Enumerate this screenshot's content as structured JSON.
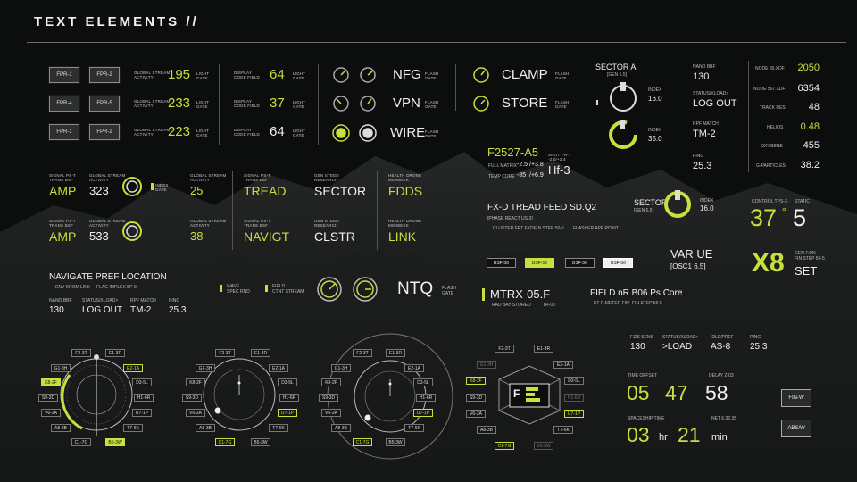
{
  "header": {
    "title": "TEXT ELEMENTS //"
  },
  "colors": {
    "accent": "#c8df3e",
    "text": "#f0f0f0",
    "bg": "#0c0d0d"
  },
  "fpr_block": {
    "buttons": [
      "FPR-1",
      "FPR-2",
      "FPR-4",
      "FPR-5",
      "FPR-1",
      "FPR-2"
    ],
    "rows": [
      {
        "label": "GLOBAL STREAM\nACTIVITY",
        "value": "195",
        "unit": "LIGHT\nGATE",
        "label2": "DISPLAY\nCODE FIELD",
        "value2": "64",
        "unit2": "LIGHT\nGATE"
      },
      {
        "label": "GLOBAL STREAM\nACTIVITY",
        "value": "233",
        "unit": "LIGHT\nGATE",
        "label2": "DISPLAY\nCODE FIELD",
        "value2": "37",
        "unit2": "LIGHT\nGATE"
      },
      {
        "label": "GLOBAL STREAM\nACTIVITY",
        "value": "223",
        "unit": "LIGHT\nGATE",
        "label2": "DISPLAY\nCODE FIELD",
        "value2": "64",
        "unit2": "LIGHT\nGATE"
      }
    ]
  },
  "knob_words": [
    {
      "word": "NFG",
      "unit": "FLASH\nGATE"
    },
    {
      "word": "VPN",
      "unit": "FLASH\nGATE"
    },
    {
      "word": "WIRE",
      "unit": "FLASH\nGATE"
    }
  ],
  "clamp": {
    "a": "CLAMP",
    "a_unit": "FLASH\nGATE",
    "b": "STORE",
    "b_unit": "FLASH\nGATE"
  },
  "sector_a": {
    "title": "SECTOR A",
    "sub": "[GEN 6.5]",
    "index1_label": "INDEX",
    "index1": "16.0",
    "index2_label": "INDEX",
    "index2": "35.0"
  },
  "f2527": {
    "title": "F2527-A5",
    "r1l": "FULL MATRIX",
    "r1a": "-2.5",
    "r1b": "/+3.8",
    "r2l": "TEMP CORE",
    "r2a": "-85",
    "r2b": "/+6.9",
    "split_label": "SPLIT FR-7\n-2.0/+2.4",
    "split": "Hf-3"
  },
  "nano_col": {
    "nano_label": "NANO BBF",
    "nano": "130",
    "status_label": "STATUS/XLOAD>",
    "status": "LOG OUT",
    "rpf_label": "RPF MATCH",
    "rpf": "TM-2",
    "ping_label": "PING",
    "ping": "25.3"
  },
  "node_list": [
    {
      "label": "NODE 30.XDF",
      "value": "2050",
      "accent": true
    },
    {
      "label": "NODE 567.XDF",
      "value": "6354",
      "accent": false
    },
    {
      "label": "TRACK RES.",
      "value": "48",
      "accent": false
    },
    {
      "label": "HELIOS",
      "value": "0.48",
      "accent": true
    },
    {
      "label": "OXYGENE",
      "value": "455",
      "accent": false
    },
    {
      "label": "G-PARTICLES",
      "value": "38.2",
      "accent": false
    }
  ],
  "amp_rows": [
    {
      "lbl1": "SIGNAL PS-T\nTRANS BSF",
      "w1": "AMP",
      "lbl2": "GLOBAL STREAM\nACTIVITY",
      "n2": "323",
      "lbl3": "GLOBAL STREAM\nACTIVITY",
      "n3": "25",
      "lbl4": "SIGNAL PS-T\nTRANS BSF",
      "w4": "TREAD",
      "lbl5": "GEN STEED\nRESEARCH",
      "w5": "SECTOR",
      "lbl6": "HEALTH DRONE\nMIDWEEK",
      "w6": "FDDS",
      "side": "INDEX\nGATE"
    },
    {
      "lbl1": "SIGNAL PS-T\nTRANS BSF",
      "w1": "AMP",
      "lbl2": "GLOBAL STREAM\nACTIVITY",
      "n2": "533",
      "lbl3": "GLOBAL STREAM\nACTIVITY",
      "n3": "38",
      "lbl4": "SIGNAL PS-T\nTRANS BSF",
      "w4": "NAVIGT",
      "lbl5": "GEN STEED\nRESEARCH",
      "w5": "CLSTR",
      "lbl6": "HEALTH DRONE\nMIDWEEK",
      "w6": "LINK",
      "side": ""
    }
  ],
  "fxd": {
    "title": "FX-D TREAD FEED SD.Q2",
    "sub": "[PHASE REACT US-3]",
    "o1": "CLUSTER FRT FKD",
    "o2": "FIN STEP 50-5",
    "o3": "FLASHER APP POINT"
  },
  "sector_b": {
    "title": "SECTOR",
    "sub": "[GEN 6.5]",
    "index_label": "INDEX",
    "index": "16.0"
  },
  "control": {
    "label": "CONTROL TPS-3",
    "value": "37",
    "static_label": "STATIC",
    "static": "5"
  },
  "chips": [
    "BSF-56",
    "BSF-56",
    "BSF-56",
    "BSF-56"
  ],
  "var": {
    "title": "VAR UE",
    "sub": "[OSC1 6.5]"
  },
  "x8": {
    "big": "X8",
    "gen": "GEN-F.DN\nFIN STEP 50-5",
    "set": "SET"
  },
  "navigate": {
    "title": "NAVIGATE PREF LOCATION",
    "o1": "ENV KROM LINK",
    "o2": "FLAG IMPLEX 5P-9",
    "nano_label": "NANO BBF",
    "nano": "130",
    "status_label": "STATUS/XLOAD>",
    "status": "LOG OUT",
    "rpf_label": "RPF MATCH",
    "rpf": "TM-2",
    "ping_label": "PING",
    "ping": "25.3"
  },
  "wave": {
    "a": "WAVE\nSPEC RND",
    "b": "FIELD\nCTNT STREAM"
  },
  "ntq": {
    "word": "NTQ",
    "unit": "FLASH\nGATE"
  },
  "mtrx": {
    "title": "MTRX-05.F",
    "sub": "RAD BAY STORED",
    "sub2": "TR-00"
  },
  "field": {
    "title": "FIELD nR B06.Ps Core",
    "o1": "KT-R.METER FIN",
    "o2": "FIN STEP 50-5"
  },
  "status_row": {
    "f_label": "F.DS SENS",
    "f": "130",
    "s_label": "STATUS/XLOAD>",
    "s": ">LOAD",
    "i_label": "IDLE/PREF",
    "i": "AS-8",
    "p_label": "PING",
    "p": "25.3"
  },
  "time": {
    "offset_label": "TIME OFFSET",
    "h": "05",
    "m": "47",
    "delay_label": "DELAY Z-03",
    "d": "58",
    "ship_label": "SPACESHIP TIME",
    "net_label": "NET 6.32.35",
    "sh": "03",
    "hr": "hr",
    "sm": "21",
    "min": "min"
  },
  "side_buttons": [
    "FIN-W",
    "ABS/W"
  ],
  "dials": [
    {
      "left": [
        "G1-3H",
        "K8-2F",
        "S9-3D",
        "V6-2A",
        "A8-3B"
      ],
      "top": [
        "F2-3T",
        "E1-3R"
      ],
      "right": [
        "E2-1A",
        "D3-5L",
        "H1-6R",
        "U7-1P",
        "T7-6K"
      ],
      "bottom": [
        "C1-7G",
        "B5-3W"
      ]
    },
    {
      "left": [
        "G1-3H",
        "K8-2F",
        "S9-3D",
        "V6-2A",
        "A8-3B"
      ],
      "top": [
        "F2-3T",
        "E1-3R"
      ],
      "right": [
        "E2-1A",
        "D3-5L",
        "H1-6R",
        "U7-1P",
        "T7-6K"
      ],
      "bottom": [
        "C1-7G",
        "B5-3W"
      ]
    },
    {
      "left": [
        "G1-3H",
        "K8-2F",
        "S9-3D",
        "V6-2A",
        "A8-3B"
      ],
      "top": [
        "F2-3T",
        "E1-3R"
      ],
      "right": [
        "E2-1A",
        "D3-5L",
        "H1-6R",
        "U7-1P",
        "T7-6K"
      ],
      "bottom": [
        "C1-7G",
        "B5-3W"
      ]
    },
    {
      "left": [
        "G1-3H",
        "K8-2F",
        "S9-3D",
        "V6-2A",
        "A8-3B"
      ],
      "top": [
        "F2-3T",
        "E1-3R"
      ],
      "right": [
        "E2-1A",
        "D3-5L",
        "H1-6R",
        "U7-1P",
        "T7-6K"
      ],
      "bottom": [
        "C1-7G",
        "B5-3W"
      ],
      "center": "F"
    }
  ]
}
